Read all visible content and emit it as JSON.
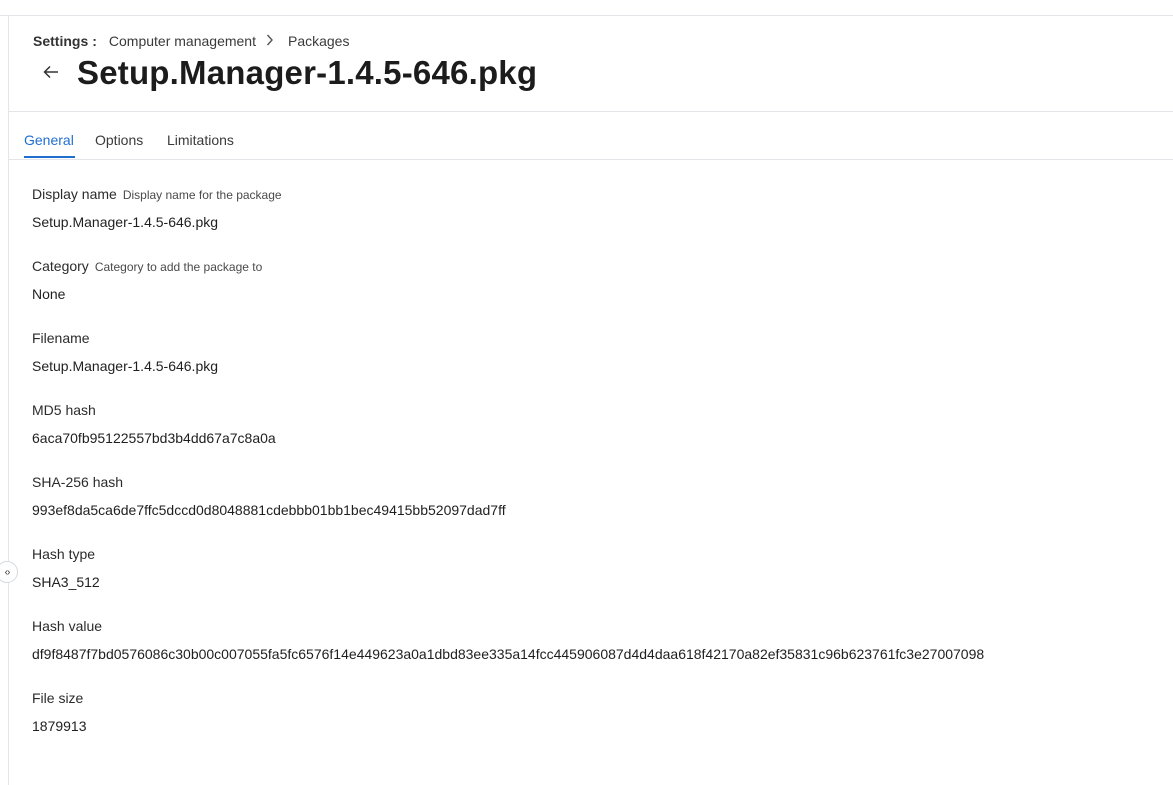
{
  "breadcrumb": {
    "root": "Settings",
    "separator": ":",
    "items": [
      "Computer management",
      "Packages"
    ]
  },
  "page": {
    "title": "Setup.Manager-1.4.5-646.pkg"
  },
  "tabs": [
    {
      "label": "General",
      "active": true
    },
    {
      "label": "Options",
      "active": false
    },
    {
      "label": "Limitations",
      "active": false
    }
  ],
  "fields": {
    "display_name": {
      "label": "Display name",
      "hint": "Display name for the package",
      "value": "Setup.Manager-1.4.5-646.pkg"
    },
    "category": {
      "label": "Category",
      "hint": "Category to add the package to",
      "value": "None"
    },
    "filename": {
      "label": "Filename",
      "value": "Setup.Manager-1.4.5-646.pkg"
    },
    "md5": {
      "label": "MD5 hash",
      "value": "6aca70fb95122557bd3b4dd67a7c8a0a"
    },
    "sha256": {
      "label": "SHA-256 hash",
      "value": "993ef8da5ca6de7ffc5dccd0d8048881cdebbb01bb1bec49415bb52097dad7ff"
    },
    "hash_type": {
      "label": "Hash type",
      "value": "SHA3_512"
    },
    "hash_value": {
      "label": "Hash value",
      "value": "df9f8487f7bd0576086c30b00c007055fa5fc6576f14e449623a0a1dbd83ee335a14fcc445906087d4d4daa618f42170a82ef35831c96b623761fc3e27007098"
    },
    "file_size": {
      "label": "File size",
      "value": "1879913"
    }
  },
  "icons": {
    "back": "arrow-left-icon",
    "chevron": "chevron-right-icon",
    "collapse": "expand-collapse-icon"
  },
  "colors": {
    "accent": "#1f6fd1",
    "divider": "#e3e5e8"
  }
}
